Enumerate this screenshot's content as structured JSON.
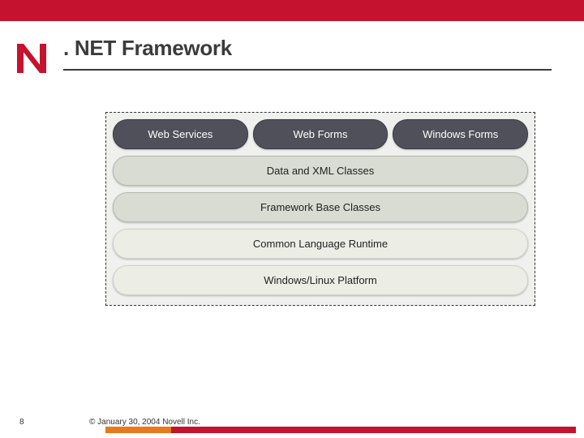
{
  "header": {
    "title": ". NET Framework",
    "logo_letter": "N"
  },
  "diagram": {
    "row0": [
      "Web Services",
      "Web Forms",
      "Windows Forms"
    ],
    "row1": "Data and XML Classes",
    "row2": "Framework Base Classes",
    "row3": "Common Language Runtime",
    "row4": "Windows/Linux Platform"
  },
  "footer": {
    "page": "8",
    "copyright": "© January 30, 2004 Novell Inc."
  },
  "colors": {
    "brand_red": "#c4122f",
    "accent_orange": "#e57b1e",
    "pill_dark": "#50505a",
    "pill_light": "#d8dcd2"
  }
}
